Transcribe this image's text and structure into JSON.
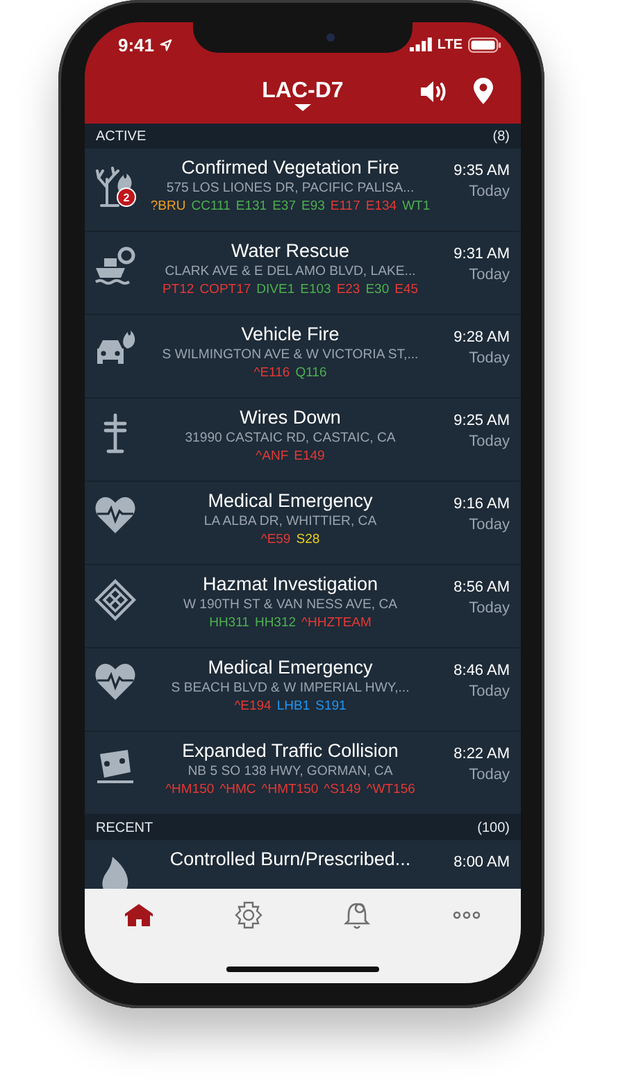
{
  "status_bar": {
    "time": "9:41",
    "network": "LTE"
  },
  "header": {
    "title": "LAC-D7"
  },
  "sections": [
    {
      "title": "ACTIVE",
      "count": "(8)",
      "incidents": [
        {
          "kind": "tree-fire",
          "badge": "2",
          "title": "Confirmed Vegetation Fire",
          "address": "575 LOS LIONES DR, PACIFIC PALISA...",
          "units": [
            {
              "label": "?BRU",
              "color": "#f0a020"
            },
            {
              "label": "CC111",
              "color": "#4caf50"
            },
            {
              "label": "E131",
              "color": "#4caf50"
            },
            {
              "label": "E37",
              "color": "#4caf50"
            },
            {
              "label": "E93",
              "color": "#4caf50"
            },
            {
              "label": "E117",
              "color": "#e53935"
            },
            {
              "label": "E134",
              "color": "#e53935"
            },
            {
              "label": "WT1",
              "color": "#4caf50"
            }
          ],
          "time": "9:35 AM",
          "day": "Today"
        },
        {
          "kind": "boat",
          "title": "Water Rescue",
          "address": "CLARK AVE & E DEL AMO BLVD, LAKE...",
          "units": [
            {
              "label": "PT12",
              "color": "#e53935"
            },
            {
              "label": "COPT17",
              "color": "#e53935"
            },
            {
              "label": "DIVE1",
              "color": "#4caf50"
            },
            {
              "label": "E103",
              "color": "#4caf50"
            },
            {
              "label": "E23",
              "color": "#e53935"
            },
            {
              "label": "E30",
              "color": "#4caf50"
            },
            {
              "label": "E45",
              "color": "#e53935"
            }
          ],
          "time": "9:31 AM",
          "day": "Today"
        },
        {
          "kind": "car-fire",
          "title": "Vehicle Fire",
          "address": "S WILMINGTON AVE & W VICTORIA ST,...",
          "units": [
            {
              "label": "^E116",
              "color": "#e53935"
            },
            {
              "label": "Q116",
              "color": "#4caf50"
            }
          ],
          "time": "9:28 AM",
          "day": "Today"
        },
        {
          "kind": "pole",
          "title": "Wires Down",
          "address": "31990 CASTAIC RD, CASTAIC, CA",
          "units": [
            {
              "label": "^ANF",
              "color": "#e53935"
            },
            {
              "label": "E149",
              "color": "#e53935"
            }
          ],
          "time": "9:25 AM",
          "day": "Today"
        },
        {
          "kind": "heart",
          "title": "Medical Emergency",
          "address": "LA ALBA DR, WHITTIER, CA",
          "units": [
            {
              "label": "^E59",
              "color": "#e53935"
            },
            {
              "label": "S28",
              "color": "#e8d020"
            }
          ],
          "time": "9:16 AM",
          "day": "Today"
        },
        {
          "kind": "diamond",
          "title": "Hazmat Investigation",
          "address": "W 190TH ST & VAN NESS AVE, CA",
          "units": [
            {
              "label": "HH311",
              "color": "#4caf50"
            },
            {
              "label": "HH312",
              "color": "#4caf50"
            },
            {
              "label": "^HHZTEAM",
              "color": "#e53935"
            }
          ],
          "time": "8:56 AM",
          "day": "Today"
        },
        {
          "kind": "heart",
          "title": "Medical Emergency",
          "address": "S BEACH BLVD & W IMPERIAL HWY,...",
          "units": [
            {
              "label": "^E194",
              "color": "#e53935"
            },
            {
              "label": "LHB1",
              "color": "#2196f3"
            },
            {
              "label": "S191",
              "color": "#2196f3"
            }
          ],
          "time": "8:46 AM",
          "day": "Today"
        },
        {
          "kind": "car-crash",
          "title": "Expanded Traffic Collision",
          "address": "NB 5 SO 138 HWY, GORMAN, CA",
          "units": [
            {
              "label": "^HM150",
              "color": "#e53935"
            },
            {
              "label": "^HMC",
              "color": "#e53935"
            },
            {
              "label": "^HMT150",
              "color": "#e53935"
            },
            {
              "label": "^S149",
              "color": "#e53935"
            },
            {
              "label": "^WT156",
              "color": "#e53935"
            }
          ],
          "time": "8:22 AM",
          "day": "Today"
        }
      ]
    },
    {
      "title": "RECENT",
      "count": "(100)",
      "incidents": [
        {
          "kind": "flame",
          "title": "Controlled Burn/Prescribed...",
          "time": "8:00 AM"
        }
      ]
    }
  ],
  "tabs": [
    {
      "kind": "home",
      "selected": true
    },
    {
      "kind": "emblem",
      "selected": false
    },
    {
      "kind": "bell",
      "selected": false
    },
    {
      "kind": "more",
      "selected": false
    }
  ]
}
